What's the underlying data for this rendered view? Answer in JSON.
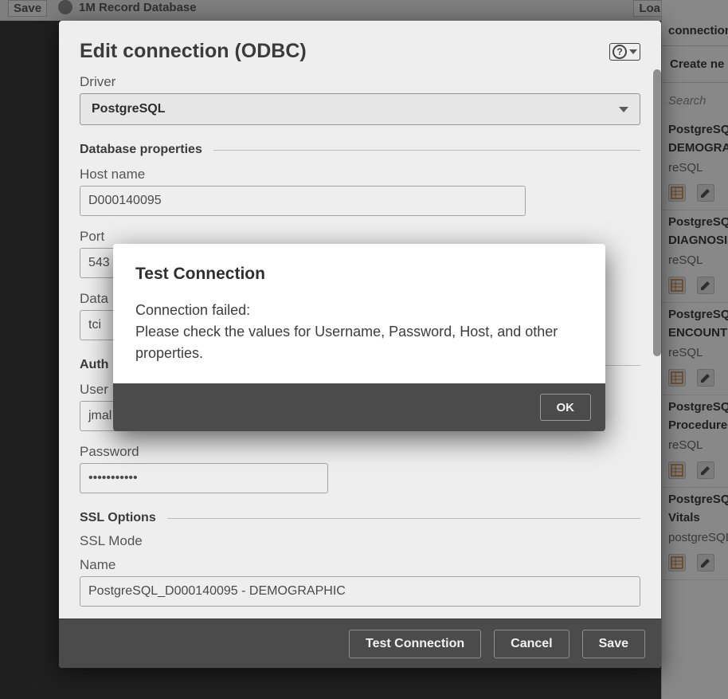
{
  "bg": {
    "save": "Save",
    "db_label": "1M Record Database",
    "load": "Loa",
    "right_head": "connections",
    "create_new": "Create ne",
    "search_placeholder": "Search",
    "items": [
      {
        "title": "PostgreSQL",
        "sub": "DEMOGRAP",
        "meta": "reSQL"
      },
      {
        "title": "PostgreSQL",
        "sub": "DIAGNOSIS",
        "meta": "reSQL"
      },
      {
        "title": "PostgreSQL",
        "sub": "ENCOUNTE",
        "meta": "reSQL"
      },
      {
        "title": "PostgreSQL",
        "sub": "Procedures",
        "meta": "reSQL"
      },
      {
        "title": "PostgreSQL",
        "sub": "Vitals",
        "meta": "postgreSQL"
      }
    ]
  },
  "dialog": {
    "title": "Edit connection (ODBC)",
    "driver_label": "Driver",
    "driver_value": "PostgreSQL",
    "section_db": "Database properties",
    "host_label": "Host name",
    "host_value": "D000140095",
    "port_label": "Port",
    "port_value": "543",
    "database_label": "Data",
    "database_value": "tci",
    "section_auth": "Auth",
    "user_label": "User",
    "user_value": "jmal",
    "password_label": "Password",
    "password_value": "•••••••••••",
    "section_ssl": "SSL Options",
    "ssl_mode_label": "SSL Mode",
    "name_label": "Name",
    "name_value": "PostgreSQL_D000140095 - DEMOGRAPHIC",
    "footer": {
      "test": "Test Connection",
      "cancel": "Cancel",
      "save": "Save"
    }
  },
  "alert": {
    "title": "Test Connection",
    "line1": "Connection failed:",
    "line2": "Please check the values for Username, Password, Host, and other properties.",
    "ok": "OK"
  }
}
